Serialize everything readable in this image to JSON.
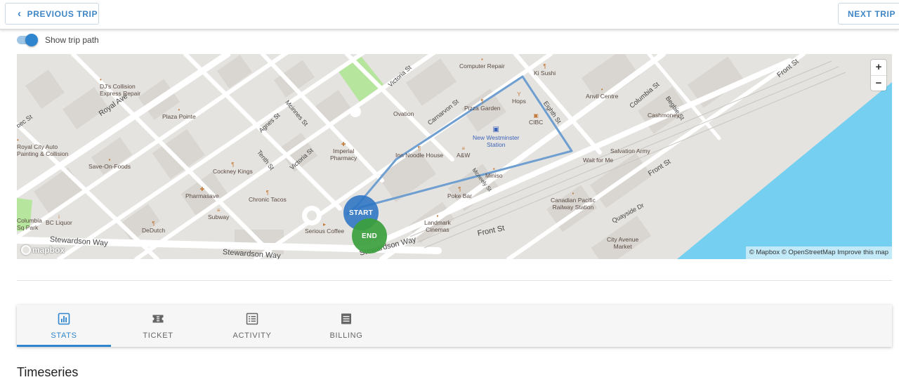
{
  "nav": {
    "previous_label": "PREVIOUS TRIP",
    "next_label": "NEXT TRIP"
  },
  "trip_path_toggle": {
    "label": "Show trip path",
    "checked": true
  },
  "map": {
    "pois": {
      "djs": "DJ's Collision\nExpress Repair",
      "royal_city": "Royal City Auto\nPainting & Collision",
      "save_on": "Save-On-Foods",
      "plaza_pointe": "Plaza Pointe",
      "cockney": "Cockney Kings",
      "pharmasave": "Pharmasave",
      "subway": "Subway",
      "chronic": "Chronic Tacos",
      "bc_liquor": "BC Liquor",
      "dedutch": "DeDutch",
      "columbia_park": "Columbia\nSq Park",
      "imperial": "Imperial\nPharmacy",
      "serious_coffee": "Serious Coffee",
      "ovation": "Ovation",
      "computer_repair": "Computer Repair",
      "ki_sushi": "Ki Sushi",
      "pizza_garden": "Pizza Garden",
      "hops": "Hops",
      "cibc": "CIBC",
      "inn_noodle": "Inn Noodle House",
      "aw": "A&W",
      "miniso": "Miniso",
      "poke_bar": "Poke Bar",
      "landmark": "Landmark\nCinemas",
      "anvil": "Anvil Centre",
      "cashmoney": "Cashmoney",
      "salvation": "Salvation Army",
      "wait_for_me": "Wait for Me",
      "cp_station": "Canadian Pacific\nRailway Station",
      "city_avenue": "City Avenue\nMarket"
    },
    "station": "New Westminster\nStation",
    "streets": {
      "royal_ave": "Royal Ave",
      "quebec": "bec St",
      "agnes": "Agnes St",
      "mcinnes": "Mcinnes St",
      "tenth": "Tenth St",
      "victoria_1": "Victoria St",
      "victoria_2": "Victoria St",
      "carnarvon": "Carnarvon St",
      "eighth": "Eighth St",
      "mcneely": "Mcneely St",
      "columbia": "Columbia St",
      "begbie": "Begbie St",
      "front_1": "Front St",
      "front_2": "Front St",
      "front_3": "Front St",
      "quayside": "Quayside Dr",
      "stewardson_1": "Stewardson Way",
      "stewardson_2": "Stewardson Way",
      "stewardson_3": "Stewardson Way"
    },
    "start_label": "START",
    "end_label": "END",
    "zoom_in": "+",
    "zoom_out": "−",
    "logo_text": "mapbox",
    "attribution": "© Mapbox © OpenStreetMap Improve this map",
    "colors": {
      "path": "#6e9fd0",
      "water": "#75cff0",
      "park": "#b6e59e",
      "land": "#e5e3df"
    }
  },
  "tabs": [
    {
      "label": "STATS",
      "icon": "bar-chart-icon",
      "active": true
    },
    {
      "label": "TICKET",
      "icon": "ticket-icon",
      "active": false
    },
    {
      "label": "ACTIVITY",
      "icon": "list-icon",
      "active": false
    },
    {
      "label": "BILLING",
      "icon": "receipt-icon",
      "active": false
    }
  ],
  "section": {
    "title": "Timeseries"
  }
}
